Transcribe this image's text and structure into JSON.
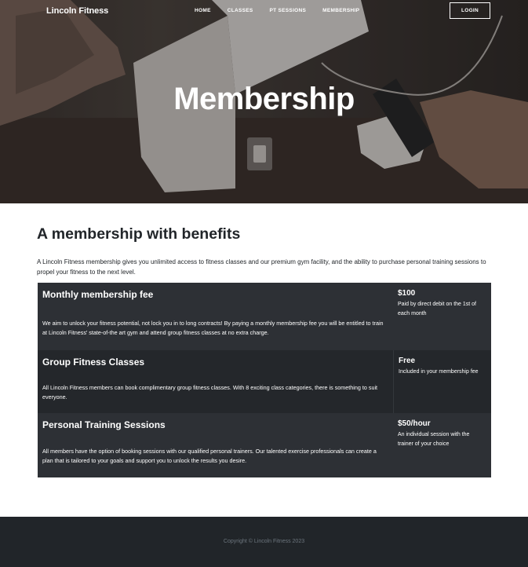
{
  "navbar": {
    "brand": "Lincoln Fitness",
    "links": [
      "HOME",
      "CLASSES",
      "PT SESSIONS",
      "MEMBERSHIP"
    ],
    "login_label": "LOGIN"
  },
  "hero": {
    "title": "Membership"
  },
  "main": {
    "heading": "A membership with benefits",
    "intro": "A Lincoln Fitness membership gives you unlimited access to fitness classes and our premium gym facility, and the ability to purchase personal training sessions to propel your fitness to the next level.",
    "plans": [
      {
        "title": "Monthly membership fee",
        "description": "We aim to unlock your fitness potential, not lock you in to long contracts! By paying a monthly membership fee you will be entitled to train at Lincoln Fitness' state-of-the art gym and attend group fitness classes at no extra charge.",
        "price": "$100",
        "note": "Paid by direct debit on the 1st of each month"
      },
      {
        "title": "Group Fitness Classes",
        "description": "All Lincoln Fitness members can book complimentary group fitness classes. With 8 exciting class categories, there is something to suit everyone.",
        "price": "Free",
        "note": "Included in your membership fee"
      },
      {
        "title": "Personal Training Sessions",
        "description": "All members have the option of booking sessions with our qualified personal trainers. Our talented exercise professionals can create a plan that is tailored to your goals and support you to unlock the results you desire.",
        "price": "$50/hour",
        "note": "An individual session with the trainer of your choice"
      }
    ]
  },
  "footer": {
    "copyright": "Copyright © Lincoln Fitness 2023"
  },
  "colors": {
    "table_light": "#2d3035",
    "table_dark": "#24272b",
    "footer_bg": "#212529",
    "text": "#212529",
    "muted": "#6c757d"
  }
}
